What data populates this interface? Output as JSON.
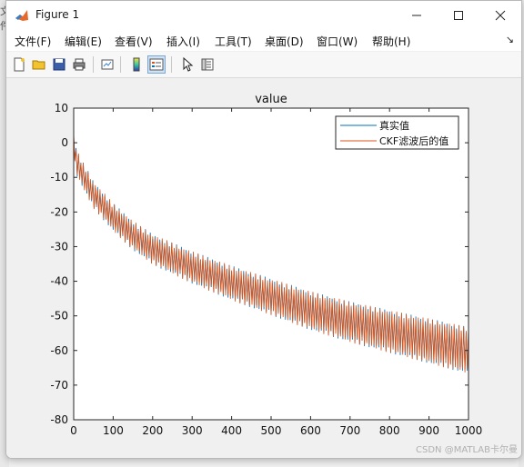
{
  "window": {
    "title": "Figure 1"
  },
  "desktop": {
    "left_fragment": "文件"
  },
  "menu": [
    {
      "label": "文件(F)"
    },
    {
      "label": "编辑(E)"
    },
    {
      "label": "查看(V)"
    },
    {
      "label": "插入(I)"
    },
    {
      "label": "工具(T)"
    },
    {
      "label": "桌面(D)"
    },
    {
      "label": "窗口(W)"
    },
    {
      "label": "帮助(H)"
    }
  ],
  "toolbar": {
    "icons": [
      "new-figure-icon",
      "open-file-icon",
      "save-icon",
      "print-icon",
      "link-plot-icon",
      "colorbar-icon",
      "legend-icon",
      "pointer-icon",
      "property-inspector-icon"
    ]
  },
  "watermark": "CSDN @MATLAB卡尔曼",
  "colors": {
    "series_true": "#0072bd",
    "series_ckf": "#d95319",
    "axes_bg": "#ffffff",
    "figure_bg": "#f0f0f0"
  },
  "chart_data": {
    "type": "line",
    "title": "value",
    "xlabel": "",
    "ylabel": "",
    "xlim": [
      0,
      1000
    ],
    "ylim": [
      -80,
      10
    ],
    "xticks": [
      0,
      100,
      200,
      300,
      400,
      500,
      600,
      700,
      800,
      900,
      1000
    ],
    "yticks": [
      10,
      0,
      -10,
      -20,
      -30,
      -40,
      -50,
      -60,
      -70,
      -80
    ],
    "legend_position": "top-right",
    "grid": false,
    "series": [
      {
        "name": "真实值",
        "color": "#0072bd",
        "trend_x": [
          0,
          10,
          50,
          100,
          150,
          200,
          300,
          400,
          500,
          600,
          700,
          800,
          900,
          1000
        ],
        "trend_upper": [
          2,
          -4,
          -13,
          -20,
          -25.5,
          -29.5,
          -35,
          -40,
          -44,
          -48.5,
          -53,
          -57,
          -61,
          -65
        ],
        "trend_lower": [
          -4,
          -9,
          -17,
          -23,
          -28,
          -32,
          -37,
          -41,
          -45,
          -48.5,
          -50.5,
          -52,
          -53.5,
          -55
        ],
        "oscillation_amplitude_start": 6,
        "oscillation_amplitude_end": 12,
        "cycles": 165
      },
      {
        "name": "CKF滤波后的值",
        "color": "#d95319",
        "trend_x": [
          0,
          10,
          50,
          100,
          150,
          200,
          300,
          400,
          500,
          600,
          700,
          800,
          900,
          1000
        ],
        "trend_upper": [
          2,
          -4,
          -13,
          -20,
          -25.5,
          -29.5,
          -35,
          -40,
          -44,
          -48.5,
          -53,
          -57,
          -61,
          -65
        ],
        "trend_lower": [
          -4,
          -9,
          -17,
          -23,
          -28,
          -32,
          -37,
          -41,
          -45,
          -48.5,
          -50.5,
          -52,
          -53.5,
          -55
        ],
        "oscillation_amplitude_start": 6,
        "oscillation_amplitude_end": 12,
        "cycles": 165
      }
    ]
  }
}
